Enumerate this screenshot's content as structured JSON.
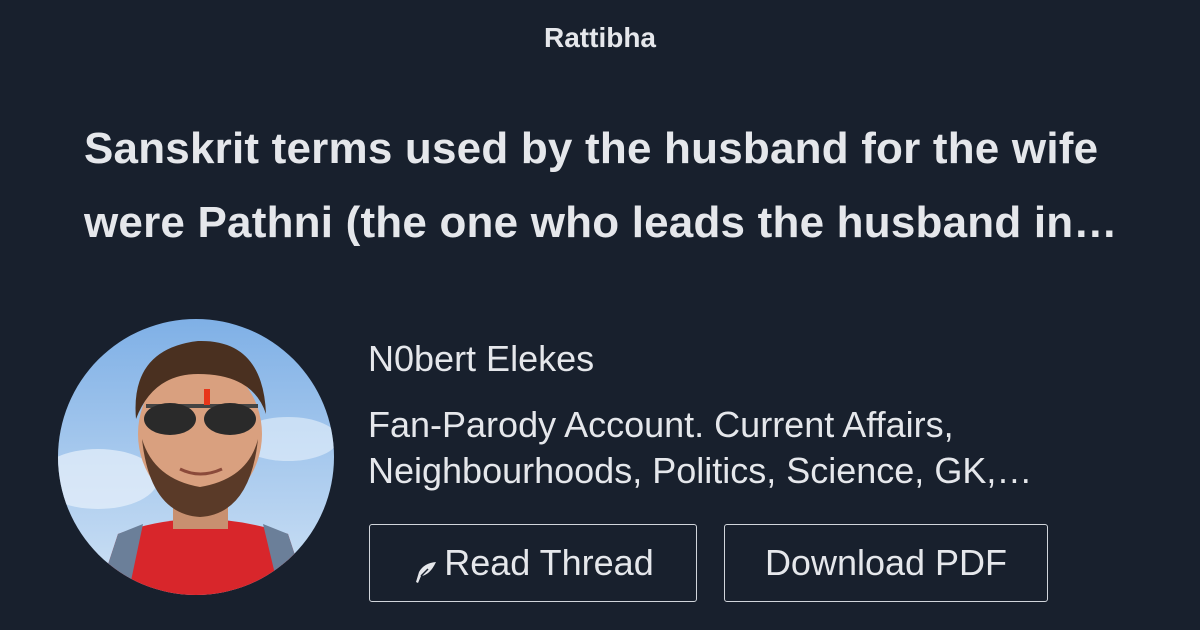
{
  "brand": "Rattibha",
  "title": "Sanskrit terms used by the husband for the wife were Pathni (the one who leads the husband in his life), Dharmapathni (the one who guides the husband in Dharma)…",
  "author": {
    "name": "N0bert Elekes",
    "bio": "Fan-Parody Account. Current Affairs, Neighbourhoods, Politics, Science, GK, History, Tech and more."
  },
  "buttons": {
    "read_thread": "Read Thread",
    "download_pdf": "Download PDF"
  },
  "icons": {
    "read_thread": "feather-icon"
  },
  "colors": {
    "background": "#18202d",
    "text": "#e5e7eb",
    "button_border": "#d1d5db"
  }
}
